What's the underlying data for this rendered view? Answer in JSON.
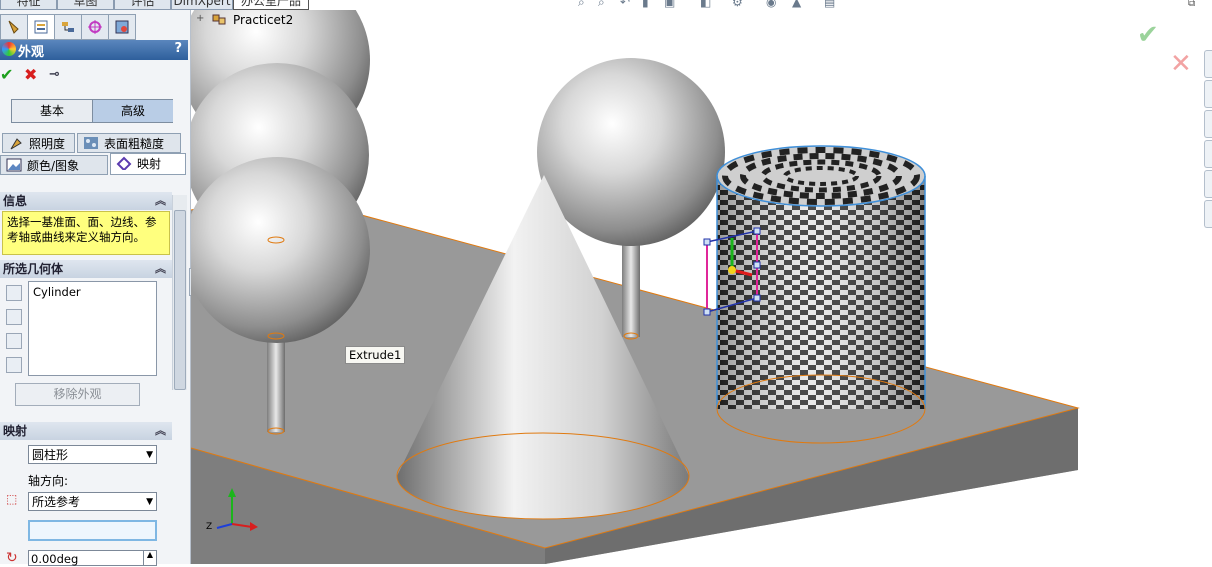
{
  "command_manager": {
    "tabs": [
      "特征",
      "草图",
      "评估",
      "DimXpert",
      "办公室产品"
    ],
    "active_tab": "办公室产品"
  },
  "feature_tree": {
    "root_part": "Practicet2"
  },
  "property_manager": {
    "title": "外观",
    "help": "?",
    "ok_icon": "green-check",
    "cancel_icon": "red-x",
    "pin_icon": "push-pin",
    "mode_tabs": [
      "基本",
      "高级"
    ],
    "active_mode": "高级",
    "subtabs_row1": [
      "照明度",
      "表面粗糙度"
    ],
    "subtabs_row2": [
      "颜色/图象",
      "映射"
    ],
    "active_subtab": "映射",
    "info": {
      "header": "信息",
      "message": "选择一基准面、面、边线、参考轴或曲线来定义轴方向。"
    },
    "selected_geometry": {
      "header": "所选几何体",
      "items": [
        "Cylinder"
      ],
      "remove_button": "移除外观"
    },
    "mapping": {
      "header": "映射",
      "mapping_type": "圆柱形",
      "axis_direction_label": "轴方向:",
      "axis_direction": "所选参考",
      "reference_value": "",
      "rotation": "0.00deg"
    }
  },
  "viewport": {
    "tooltip": "Extrude1",
    "accept_icon": "green-check",
    "reject_icon": "red-x",
    "triad_axes": [
      "X",
      "Y",
      "Z"
    ]
  },
  "colors": {
    "panel_title": "#3b6aa8",
    "info_bg": "#ffff7e",
    "selection_edge": "#e07a10",
    "ok": "#1ea01e",
    "cancel": "#d81e1e"
  }
}
